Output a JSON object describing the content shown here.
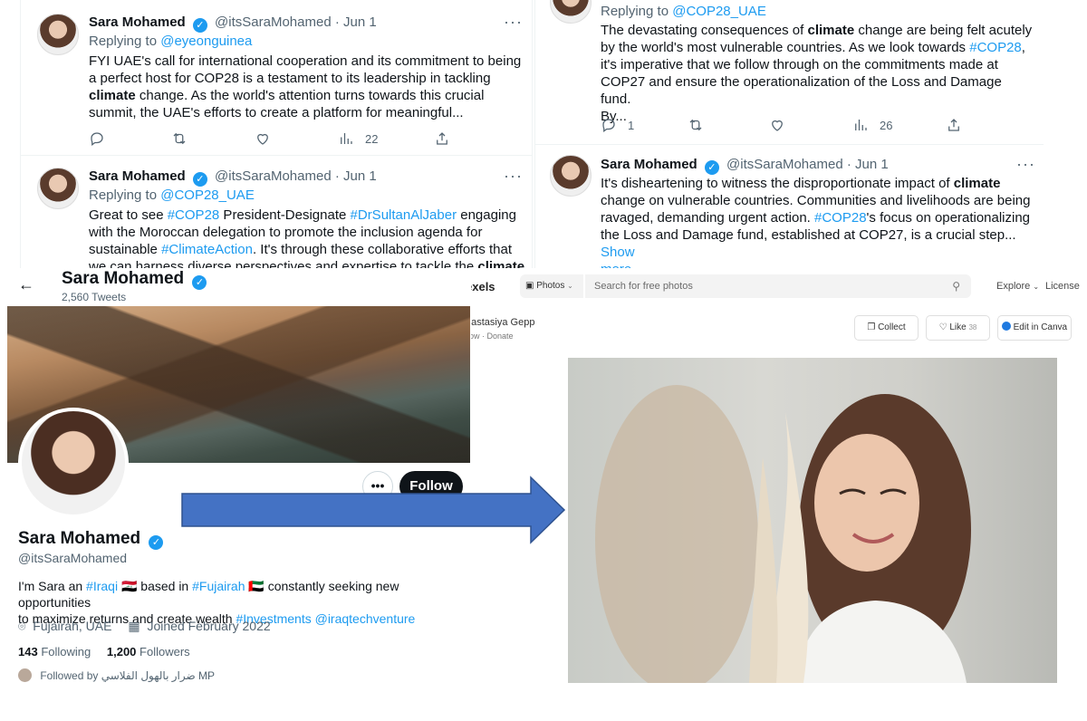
{
  "tweets_left": [
    {
      "name": "Sara Mohamed",
      "handle": "@itsSaraMohamed",
      "date": "· Jun 1",
      "reply_prefix": "Replying to",
      "reply_to": "@eyeonguinea",
      "body_1": "FYI UAE's call for international cooperation and its commitment to being",
      "body_2": "a perfect host for COP28 is a testament to its leadership in tackling",
      "body_3a": "climate",
      "body_3b": " change. As the world's attention turns towards this crucial",
      "body_4": "summit, the UAE's efforts to create a platform for meaningful...",
      "views": "22"
    },
    {
      "name": "Sara Mohamed",
      "handle": "@itsSaraMohamed",
      "date": "· Jun 1",
      "reply_prefix": "Replying to",
      "reply_to": "@COP28_UAE",
      "body_1a": "Great to see ",
      "body_1b": "#COP28",
      "body_1c": " President-Designate ",
      "body_1d": "#DrSultanAlJaber",
      "body_1e": " engaging",
      "body_2": "with the Moroccan delegation to promote the inclusion agenda for",
      "body_3a": "sustainable ",
      "body_3b": "#ClimateAction",
      "body_3c": ". It's through these collaborative efforts that",
      "body_4a": "we can harness diverse perspectives and expertise to tackle the ",
      "body_4b": "climate"
    }
  ],
  "tweets_right": [
    {
      "reply_prefix": "Replying to",
      "reply_to": "@COP28_UAE",
      "body_1a": "The devastating consequences of ",
      "body_1b": "climate",
      "body_1c": " change are being felt acutely",
      "body_2a": "by the world's most vulnerable countries. As we look towards ",
      "body_2b": "#COP28",
      "body_2c": ",",
      "body_3": "it's imperative that we follow through on the commitments made at",
      "body_4": "COP27 and ensure the operationalization of the Loss and Damage fund.",
      "body_5": "By...",
      "replies": "1",
      "views": "26"
    },
    {
      "name": "Sara Mohamed",
      "handle": "@itsSaraMohamed",
      "date": "· Jun 1",
      "body_1a": "It's disheartening to witness the disproportionate impact of ",
      "body_1b": "climate",
      "body_2": "change on vulnerable countries. Communities and livelihoods are being",
      "body_3a": "ravaged, demanding urgent action. ",
      "body_3b": "#COP28",
      "body_3c": "'s focus on operationalizing",
      "body_4a": "the Loss and Damage fund, established at COP27, is a crucial step... ",
      "body_4b": "Show",
      "body_5": "more"
    }
  ],
  "profile": {
    "header_name": "Sara Mohamed",
    "header_tweets": "2,560 Tweets",
    "name": "Sara Mohamed",
    "handle": "@itsSaraMohamed",
    "bio_1a": "I'm Sara an ",
    "bio_1b": "#Iraqi",
    "bio_1c": " 🇮🇶 based in ",
    "bio_1d": "#Fujairah",
    "bio_1e": " 🇦🇪 constantly seeking new opportunities",
    "bio_2a": "to maximize returns and create wealth ",
    "bio_2b": "#Investments",
    "bio_2c": " ",
    "bio_2d": "@iraqtechventure",
    "location": "Fujairah,  UAE",
    "joined": "Joined February 2022",
    "following_count": "143",
    "following_label": "Following",
    "followers_count": "1,200",
    "followers_label": "Followers",
    "followed_by": "Followed by ضرار بالهول الفلاسي MP",
    "more_label": "•••",
    "follow_label": "Follow"
  },
  "pexels": {
    "brand_partial": "exels",
    "photos_label": "Photos",
    "search_placeholder": "Search for free photos",
    "explore_label": "Explore",
    "license_label": "License",
    "author": "nastasiya Gepp",
    "follow_label": "llow",
    "donate_label": "Donate",
    "collect_label": "Collect",
    "like_label": "Like",
    "like_count": "38",
    "canva_label": "Edit in Canva"
  },
  "colors": {
    "accent_blue": "#1d9bf0",
    "arrow_blue": "#4472c4"
  }
}
